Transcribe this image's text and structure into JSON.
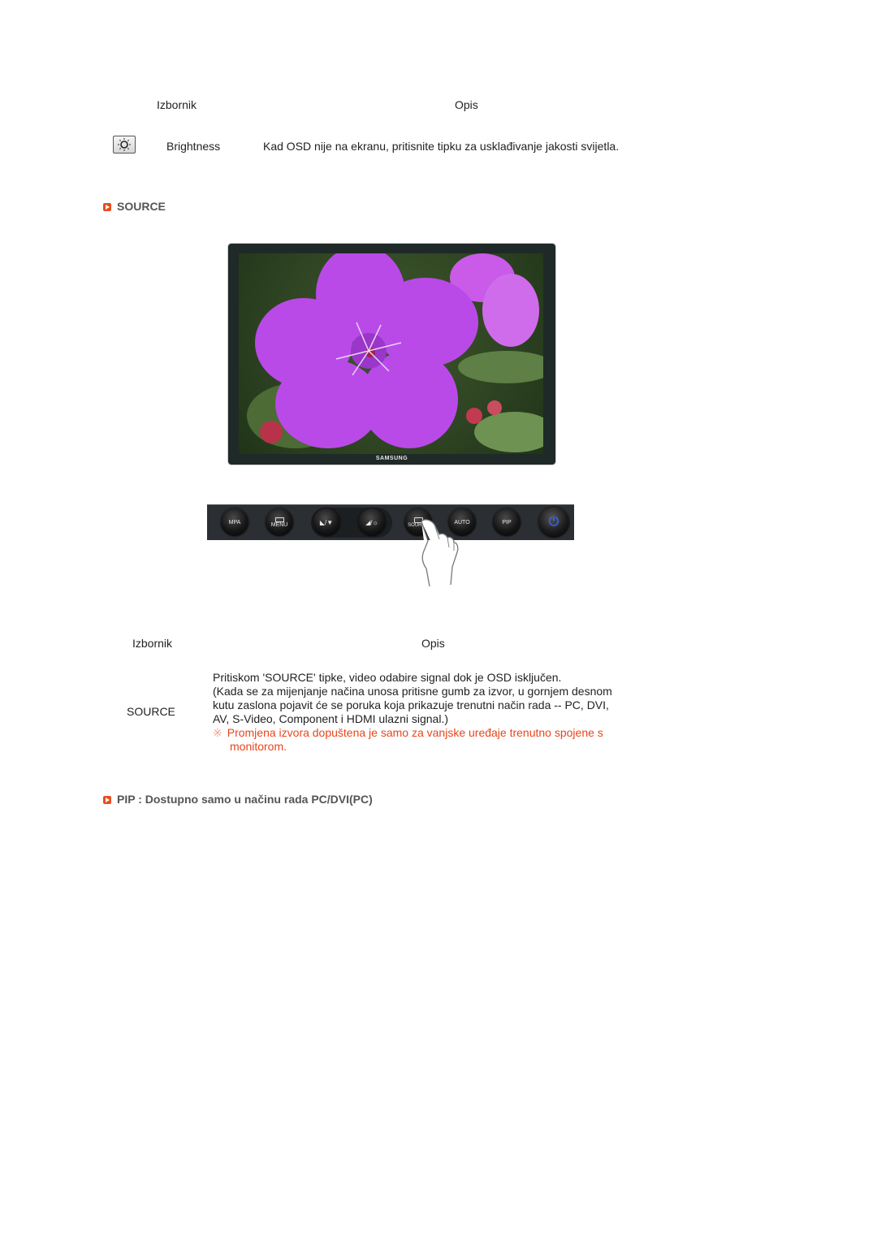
{
  "table1": {
    "header_menu": "Izbornik",
    "header_desc": "Opis",
    "row": {
      "icon": "brightness-icon",
      "label": "Brightness",
      "desc": "Kad OSD nije na ekranu, pritisnite tipku za usklađivanje jakosti svijetla."
    }
  },
  "sections": {
    "source_title": "SOURCE",
    "pip_title": "PIP : Dostupno samo u načinu rada PC/DVI(PC)"
  },
  "monitor": {
    "brand": "SAMSUNG",
    "screen_image": "purple-flower-photo"
  },
  "button_bar": {
    "buttons": [
      {
        "label": "MPA",
        "icon": ""
      },
      {
        "label": "MENU",
        "icon": "menu-icon"
      },
      {
        "label": "",
        "icon": "brightness-down-icon",
        "glyph": "◣/▼"
      },
      {
        "label": "",
        "icon": "brightness-up-icon",
        "glyph": "◢/☼"
      },
      {
        "label": "SOURCE",
        "icon": "source-icon"
      },
      {
        "label": "AUTO",
        "icon": ""
      },
      {
        "label": "PIP",
        "icon": ""
      },
      {
        "label": "",
        "icon": "power-icon",
        "glyph": "⏻"
      }
    ],
    "pressed": "SOURCE",
    "pointer": "hand-pointer-icon"
  },
  "table2": {
    "header_menu": "Izbornik",
    "header_desc": "Opis",
    "row": {
      "label": "SOURCE",
      "desc_lines": [
        "Pritiskom 'SOURCE' tipke, video odabire signal dok je OSD isključen.",
        "(Kada se za mijenjanje načina unosa pritisne gumb za izvor, u gornjem desnom",
        "kutu zaslona pojavit će se poruka koja prikazuje trenutni način rada -- PC, DVI,",
        "AV, S-Video, Component i HDMI ulazni signal.)"
      ],
      "note_mark": "※",
      "note_lines": [
        "Promjena izvora dopuštena je samo za vanjske uređaje trenutno spojene s",
        "monitorom."
      ]
    }
  },
  "colors": {
    "accent": "#e84c1e",
    "note_text": "#e8451b",
    "section_title": "#555555"
  }
}
